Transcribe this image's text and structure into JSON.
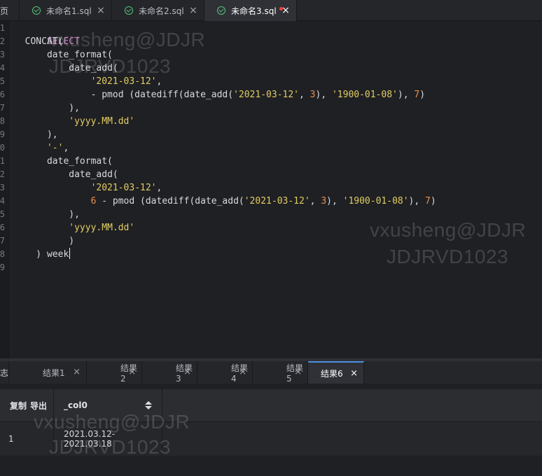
{
  "top_tabs": [
    {
      "label": "页"
    },
    {
      "label": "未命名1.sql",
      "close": "×"
    },
    {
      "label": "未命名2.sql",
      "close": "×"
    },
    {
      "label": "未命名3.sql",
      "close": "×"
    }
  ],
  "editor": {
    "line_numbers": [
      "1",
      "2",
      "3",
      "4",
      "5",
      "6",
      "7",
      "8",
      "9",
      "0",
      "1",
      "2",
      "3",
      "4",
      "5",
      "6",
      "7",
      "8",
      "9"
    ],
    "code": {
      "l1_kw": "SELECT",
      "l2_pre": "  ",
      "l2_fn": "CONCAT(",
      "l3_pre": "      ",
      "l3_fn": "date_format(",
      "l4_pre": "          ",
      "l4_fn": "date_add(",
      "l5_pre": "              ",
      "l5_str": "'2021-03-12'",
      "l5_post": ",",
      "l6_pre": "              - pmod (datediff(date_add(",
      "l6_str1": "'2021-03-12'",
      "l6_mid1": ", ",
      "l6_num1": "3",
      "l6_mid2": "), ",
      "l6_str2": "'1900-01-08'",
      "l6_mid3": "), ",
      "l6_num2": "7",
      "l6_post": ")",
      "l7": "          ),",
      "l8_pre": "          ",
      "l8_str": "'yyyy.MM.dd'",
      "l9": "      ),",
      "l10_pre": "      ",
      "l10_str": "'-'",
      "l10_post": ",",
      "l11_pre": "      ",
      "l11_fn": "date_format(",
      "l12_pre": "          ",
      "l12_fn": "date_add(",
      "l13_pre": "              ",
      "l13_str": "'2021-03-12'",
      "l13_post": ",",
      "l14_pre": "              ",
      "l14_num": "6",
      "l14_mid": " - pmod (datediff(date_add(",
      "l14_str1": "'2021-03-12'",
      "l14_mid2": ", ",
      "l14_num2": "3",
      "l14_mid3": "), ",
      "l14_str2": "'1900-01-08'",
      "l14_mid4": "), ",
      "l14_num3": "7",
      "l14_post": ")",
      "l15": "          ),",
      "l16_pre": "          ",
      "l16_str": "'yyyy.MM.dd'",
      "l17": "          )",
      "l18_pre": "    ) ",
      "l18_text": "week"
    }
  },
  "watermarks": [
    "vxusheng@JDJR",
    "JDJRVD1023",
    "vxusheng@JDJR",
    "JDJRVD1023",
    "vxusheng@JDJR",
    "JDJRVD1023"
  ],
  "result_tabs": [
    {
      "label": "志"
    },
    {
      "label": "结果1",
      "close": "×"
    },
    {
      "label": "结果2",
      "close": "×"
    },
    {
      "label": "结果3",
      "close": "×"
    },
    {
      "label": "结果4",
      "close": "×"
    },
    {
      "label": "结果5",
      "close": "×"
    },
    {
      "label": "结果6",
      "close": "×"
    }
  ],
  "result_grid": {
    "header": {
      "copy": "复制",
      "export": "导出",
      "column": "_col0"
    },
    "rows": [
      {
        "index": "1",
        "value": "2021.03.12-2021.03.18"
      }
    ]
  },
  "icons": {
    "saved": "check-circle-icon",
    "close": "close-icon",
    "sort": "sort-icon"
  },
  "colors": {
    "background": "#1e1f22",
    "keyword": "#c586c0",
    "string": "#e2cc64",
    "number": "#f08d49",
    "active_tab": "#2f3136",
    "accent": "#4a90e2",
    "success": "#57c37d"
  }
}
